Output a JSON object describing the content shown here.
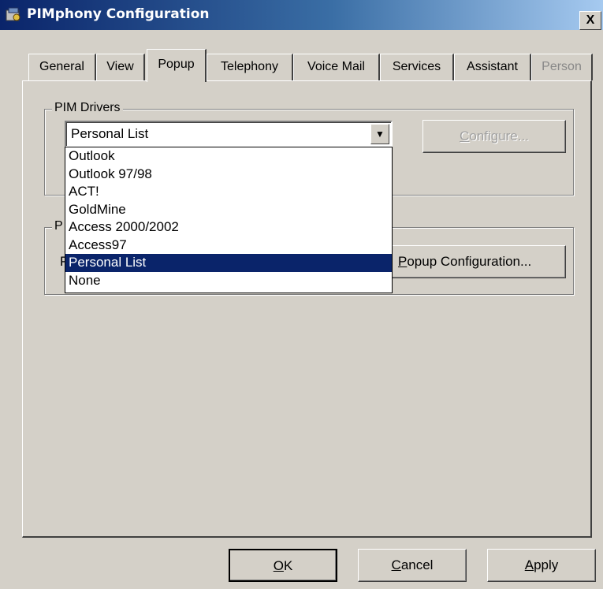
{
  "window": {
    "title": "PIMphony Configuration",
    "close_label": "X",
    "app_icon": "pimphony-app-icon"
  },
  "tabs": [
    {
      "label": "General"
    },
    {
      "label": "View"
    },
    {
      "label": "Popup",
      "active": true
    },
    {
      "label": "Telephony"
    },
    {
      "label": "Voice Mail"
    },
    {
      "label": "Services"
    },
    {
      "label": "Assistant"
    },
    {
      "label": "Person",
      "disabled": true
    }
  ],
  "pim_drivers": {
    "group_label": "PIM Drivers",
    "selected_value": "Personal List",
    "configure_button": {
      "label": "Configure...",
      "mnemonic": "C",
      "rest": "onfigure...",
      "disabled": true
    },
    "options": [
      "Outlook",
      "Outlook 97/98",
      "ACT!",
      "GoldMine",
      "Access 2000/2002",
      "Access97",
      "Personal List",
      "None"
    ],
    "highlighted_option": "Personal List"
  },
  "popup_group": {
    "group_label_visible": "P",
    "left_label_visible": "P",
    "popup_config_button": {
      "label": "Popup Configuration...",
      "mnemonic": "P",
      "rest": "opup Configuration..."
    }
  },
  "footer": {
    "ok": {
      "label": "OK",
      "mnemonic": "O",
      "rest": "K"
    },
    "cancel": {
      "label": "Cancel",
      "mnemonic": "C",
      "rest": "ancel"
    },
    "apply": {
      "label": "Apply",
      "mnemonic": "A",
      "rest": "pply"
    }
  },
  "colors": {
    "face": "#d4d0c8",
    "title_gradient_start": "#0a246a",
    "title_gradient_end": "#a6caf0",
    "selection": "#0a246a"
  }
}
